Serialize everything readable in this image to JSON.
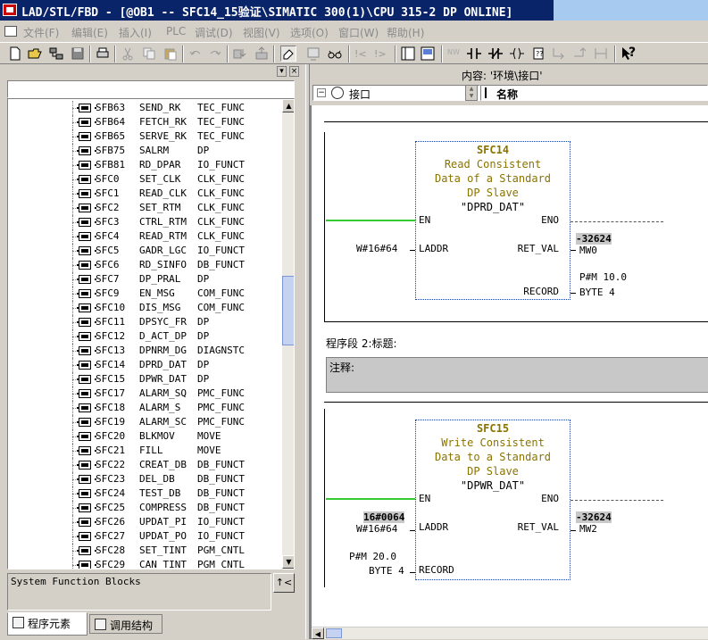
{
  "window": {
    "title": "LAD/STL/FBD  - [@OB1 -- SFC14_15验证\\SIMATIC 300(1)\\CPU 315-2 DP  ONLINE]"
  },
  "menu": [
    "文件(F)",
    "编辑(E)",
    "插入(I)",
    "PLC",
    "调试(D)",
    "视图(V)",
    "选项(O)",
    "窗口(W)",
    "帮助(H)"
  ],
  "toolbar": {
    "glyphs": [
      "?"
    ]
  },
  "left_pane": {
    "search_value": "",
    "info_text": "System Function Blocks",
    "info_button": "↑<",
    "tabs": [
      "程序元素",
      "调用结构"
    ],
    "tree": [
      {
        "name": "SFB63",
        "desc": "SEND_RK",
        "family": "TEC_FUNC"
      },
      {
        "name": "SFB64",
        "desc": "FETCH_RK",
        "family": "TEC_FUNC"
      },
      {
        "name": "SFB65",
        "desc": "SERVE_RK",
        "family": "TEC_FUNC"
      },
      {
        "name": "SFB75",
        "desc": "SALRM",
        "family": "DP"
      },
      {
        "name": "SFB81",
        "desc": "RD_DPAR",
        "family": "IO_FUNCT"
      },
      {
        "name": "SFC0",
        "desc": "SET_CLK",
        "family": "CLK_FUNC"
      },
      {
        "name": "SFC1",
        "desc": "READ_CLK",
        "family": "CLK_FUNC"
      },
      {
        "name": "SFC2",
        "desc": "SET_RTM",
        "family": "CLK_FUNC"
      },
      {
        "name": "SFC3",
        "desc": "CTRL_RTM",
        "family": "CLK_FUNC"
      },
      {
        "name": "SFC4",
        "desc": "READ_RTM",
        "family": "CLK_FUNC"
      },
      {
        "name": "SFC5",
        "desc": "GADR_LGC",
        "family": "IO_FUNCT"
      },
      {
        "name": "SFC6",
        "desc": "RD_SINFO",
        "family": "DB_FUNCT"
      },
      {
        "name": "SFC7",
        "desc": "DP_PRAL",
        "family": "DP"
      },
      {
        "name": "SFC9",
        "desc": "EN_MSG",
        "family": "COM_FUNC"
      },
      {
        "name": "SFC10",
        "desc": "DIS_MSG",
        "family": "COM_FUNC"
      },
      {
        "name": "SFC11",
        "desc": "DPSYC_FR",
        "family": "DP"
      },
      {
        "name": "SFC12",
        "desc": "D_ACT_DP",
        "family": "DP"
      },
      {
        "name": "SFC13",
        "desc": "DPNRM_DG",
        "family": "DIAGNSTC"
      },
      {
        "name": "SFC14",
        "desc": "DPRD_DAT",
        "family": "DP"
      },
      {
        "name": "SFC15",
        "desc": "DPWR_DAT",
        "family": "DP"
      },
      {
        "name": "SFC17",
        "desc": "ALARM_SQ",
        "family": "PMC_FUNC"
      },
      {
        "name": "SFC18",
        "desc": "ALARM_S",
        "family": "PMC_FUNC"
      },
      {
        "name": "SFC19",
        "desc": "ALARM_SC",
        "family": "PMC_FUNC"
      },
      {
        "name": "SFC20",
        "desc": "BLKMOV",
        "family": "MOVE"
      },
      {
        "name": "SFC21",
        "desc": "FILL",
        "family": "MOVE"
      },
      {
        "name": "SFC22",
        "desc": "CREAT_DB",
        "family": "DB_FUNCT"
      },
      {
        "name": "SFC23",
        "desc": "DEL_DB",
        "family": "DB_FUNCT"
      },
      {
        "name": "SFC24",
        "desc": "TEST_DB",
        "family": "DB_FUNCT"
      },
      {
        "name": "SFC25",
        "desc": "COMPRESS",
        "family": "DB_FUNCT"
      },
      {
        "name": "SFC26",
        "desc": "UPDAT_PI",
        "family": "IO_FUNCT"
      },
      {
        "name": "SFC27",
        "desc": "UPDAT_PO",
        "family": "IO_FUNCT"
      },
      {
        "name": "SFC28",
        "desc": "SET_TINT",
        "family": "PGM_CNTL"
      },
      {
        "name": "SFC29",
        "desc": "CAN_TINT",
        "family": "PGM_CNTL"
      }
    ]
  },
  "right_pane": {
    "content_label": "内容:  '环境\\接口'",
    "interface_label": "接口",
    "name_header": "名称",
    "toggle": "−",
    "network1": {
      "block_name": "SFC14",
      "block_lines": [
        "Read Consistent",
        "Data of a Standard",
        "DP Slave"
      ],
      "block_symbol": "\"DPRD_DAT\"",
      "en": "EN",
      "eno": "ENO",
      "in_pin": "LADDR",
      "in_value": "W#16#64",
      "out_pin1": "RET_VAL",
      "out_val1_live": "-32624",
      "out_val1": "MW0",
      "out_pin2": "RECORD",
      "out_val2a": "P#M 10.0",
      "out_val2b": "BYTE 4"
    },
    "network2": {
      "segment_title": "程序段 2:标题:",
      "comment": "注释:",
      "block_name": "SFC15",
      "block_lines": [
        "Write Consistent",
        "Data to a Standard",
        "DP Slave"
      ],
      "block_symbol": "\"DPWR_DAT\"",
      "en": "EN",
      "eno": "ENO",
      "in_pin1": "LADDR",
      "in_val1_live": "16#0064",
      "in_val1": "W#16#64",
      "in_pin2": "RECORD",
      "in_val2a": "P#M 20.0",
      "in_val2b": "BYTE 4",
      "out_pin1": "RET_VAL",
      "out_val1_live": "-32624",
      "out_val1": "MW2"
    }
  }
}
